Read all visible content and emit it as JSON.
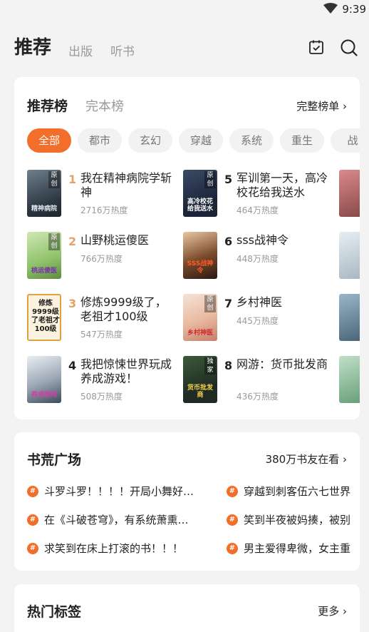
{
  "status": {
    "time": "9:39"
  },
  "nav": {
    "tabs": [
      "推荐",
      "出版",
      "听书"
    ]
  },
  "ranking": {
    "title": "推荐榜",
    "alt_title": "完本榜",
    "link": "完整榜单 ›",
    "chips": [
      "全部",
      "都市",
      "玄幻",
      "穿越",
      "系统",
      "重生",
      "战"
    ],
    "books": [
      {
        "rank": "1",
        "title": "我在精神病院学斩神",
        "heat": "2716万热度",
        "badge": "原创",
        "cover_text": "精神病院"
      },
      {
        "rank": "2",
        "title": "山野桃运傻医",
        "heat": "766万热度",
        "badge": "原创",
        "cover_text": "桃运傻医"
      },
      {
        "rank": "3",
        "title": "修炼9999级了，老祖才100级",
        "heat": "547万热度",
        "badge": "",
        "cover_text": "修炼9999级了老祖才100级"
      },
      {
        "rank": "4",
        "title": "我把惊悚世界玩成养成游戏！",
        "heat": "508万热度",
        "badge": "",
        "cover_text": "养成游戏"
      },
      {
        "rank": "5",
        "title": "军训第一天，高冷校花给我送水",
        "heat": "464万热度",
        "badge": "原创",
        "cover_text": "高冷校花给我送水"
      },
      {
        "rank": "6",
        "title": "sss战神令",
        "heat": "448万热度",
        "badge": "",
        "cover_text": "SSS战神令"
      },
      {
        "rank": "7",
        "title": "乡村神医",
        "heat": "445万热度",
        "badge": "原创",
        "cover_text": "乡村神医"
      },
      {
        "rank": "8",
        "title": "网游：货币批发商",
        "heat": "436万热度",
        "badge": "独家",
        "cover_text": "货币批发商"
      }
    ]
  },
  "square": {
    "title": "书荒广场",
    "link": "380万书友在看 ›",
    "hash": "#",
    "topics": [
      "斗罗斗罗！！！！开局小舞好…",
      "穿越到刺客伍六七世界",
      "在《斗破苍穹》，有系统萧熏…",
      "笑到半夜被妈揍，被别",
      "求笑到在床上打滚的书！！！",
      "男主爱得卑微，女主重"
    ]
  },
  "tags": {
    "title": "热门标签",
    "link": "更多 ›"
  },
  "colors": {
    "accent": "#f26e2a",
    "rank_top": "#e3a26a"
  }
}
